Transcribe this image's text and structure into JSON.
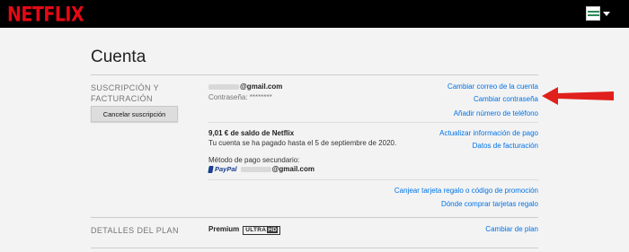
{
  "brand": {
    "logo": "NETFLIX",
    "accent": "#e50914"
  },
  "page": {
    "title": "Cuenta"
  },
  "membership": {
    "section_title": "SUSCRIPCIÓN Y FACTURACIÓN",
    "cancel_button": "Cancelar suscripción",
    "email_suffix": "@gmail.com",
    "password_label": "Contraseña: ********",
    "links": {
      "change_email": "Cambiar correo de la cuenta",
      "change_password": "Cambiar contraseña",
      "add_phone": "Añadir número de teléfono"
    },
    "balance": "9,01 € de saldo de Netflix",
    "paid_until": "Tu cuenta se ha pagado hasta el 5 de septiembre de 2020.",
    "payment_links": {
      "update_payment": "Actualizar información de pago",
      "billing_details": "Datos de facturación"
    },
    "secondary_label": "Método de pago secundario:",
    "paypal": "PayPal",
    "paypal_email_suffix": "@gmail.com",
    "gift_links": {
      "redeem": "Canjear tarjeta regalo o código de promoción",
      "buy": "Dónde comprar tarjetas regalo"
    }
  },
  "plan": {
    "section_title": "DETALLES DEL PLAN",
    "name": "Premium",
    "badge_ultra": "ULTRA",
    "badge_hd": "HD",
    "change_link": "Cambiar de plan"
  },
  "colors": {
    "link": "#0073e6",
    "annotation_arrow": "#e0201c"
  }
}
